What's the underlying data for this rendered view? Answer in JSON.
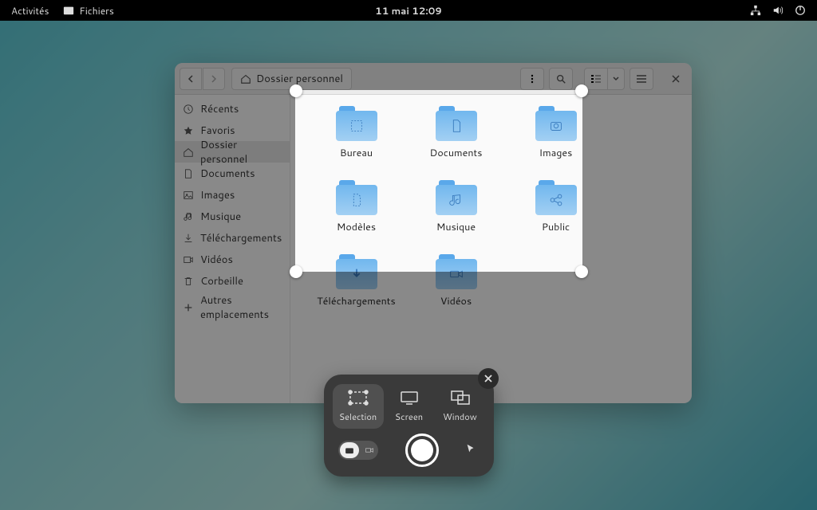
{
  "topbar": {
    "activities": "Activités",
    "app_name": "Fichiers",
    "datetime": "11 mai  12:09"
  },
  "window": {
    "path_label": "Dossier personnel",
    "sidebar": [
      {
        "icon": "clock",
        "label": "Récents"
      },
      {
        "icon": "star",
        "label": "Favoris"
      },
      {
        "icon": "home",
        "label": "Dossier personnel",
        "active": true
      },
      {
        "icon": "doc",
        "label": "Documents"
      },
      {
        "icon": "image",
        "label": "Images"
      },
      {
        "icon": "music",
        "label": "Musique"
      },
      {
        "icon": "download",
        "label": "Téléchargements"
      },
      {
        "icon": "video",
        "label": "Vidéos"
      },
      {
        "icon": "trash",
        "label": "Corbeille"
      },
      {
        "icon": "plus",
        "label": "Autres emplacements"
      }
    ],
    "folders": [
      {
        "glyph": "desktop",
        "label": "Bureau"
      },
      {
        "glyph": "doc",
        "label": "Documents"
      },
      {
        "glyph": "camera",
        "label": "Images"
      },
      {
        "glyph": "template",
        "label": "Modèles"
      },
      {
        "glyph": "music",
        "label": "Musique"
      },
      {
        "glyph": "share",
        "label": "Public"
      },
      {
        "glyph": "download",
        "label": "Téléchargements"
      },
      {
        "glyph": "video",
        "label": "Vidéos"
      }
    ]
  },
  "screenshot": {
    "modes": {
      "selection": "Selection",
      "screen": "Screen",
      "window": "Window"
    }
  }
}
